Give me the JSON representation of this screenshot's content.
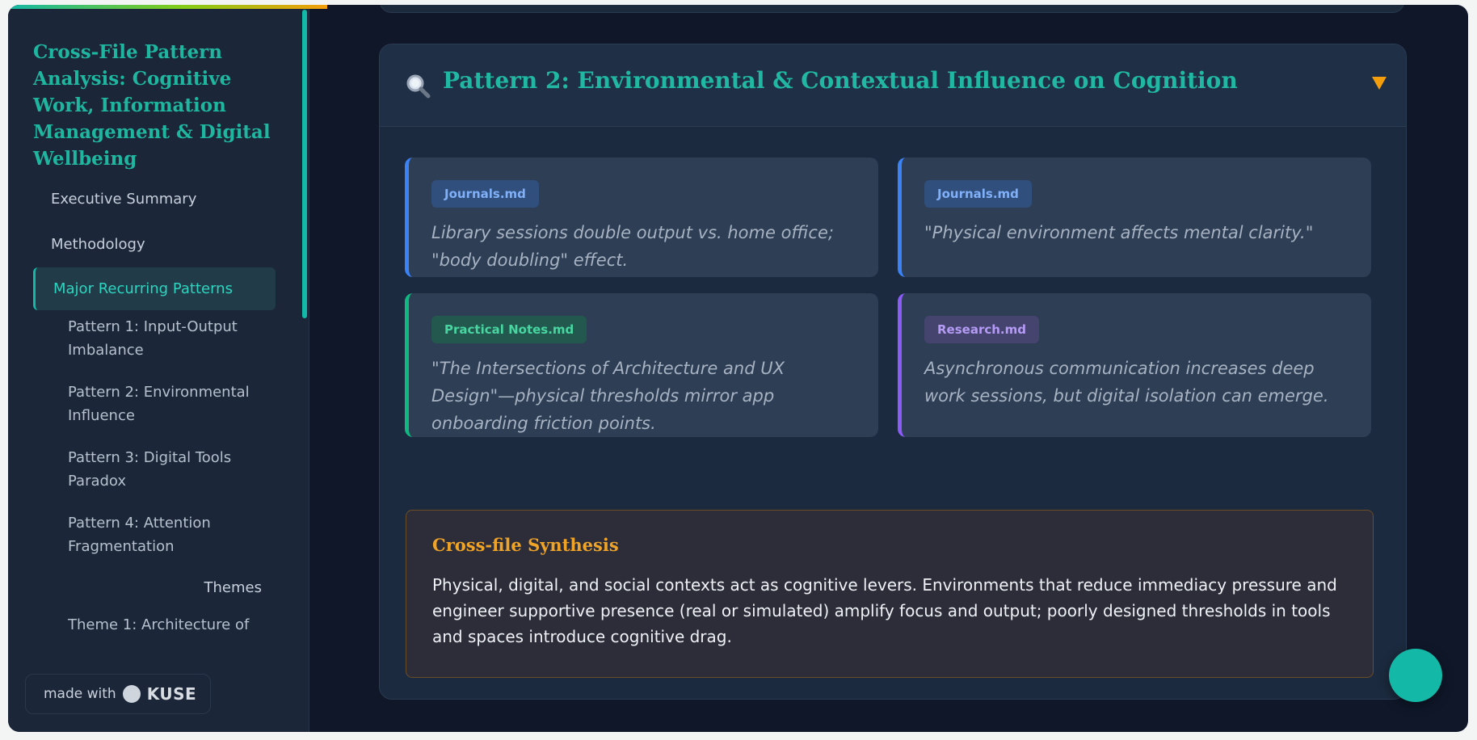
{
  "sidebar": {
    "title": "Cross-File Pattern Analysis: Cognitive Work, Information Management & Digital Wellbeing",
    "items": [
      {
        "label": "Executive Summary"
      },
      {
        "label": "Methodology"
      },
      {
        "label": "Major Recurring Patterns",
        "active": true
      }
    ],
    "subitems": [
      {
        "label": "Pattern 1: Input-Output Imbalance"
      },
      {
        "label": "Pattern 2: Environmental Influence"
      },
      {
        "label": "Pattern 3: Digital Tools Paradox"
      },
      {
        "label": "Pattern 4: Attention Fragmentation"
      }
    ],
    "partial_item": "Themes",
    "partial_subitem": "Theme 1: Architecture of"
  },
  "badge": {
    "made_with": "made with",
    "brand": "KUSE"
  },
  "pattern": {
    "icon": "search-icon",
    "title": "Pattern 2: Environmental & Contextual Influence on Cognition",
    "caret": "chevron-down-icon",
    "evidence": [
      {
        "source": "Journals.md",
        "quote": "Library sessions double output vs. home office; \"body doubling\" effect.",
        "accent": "#3b82f6"
      },
      {
        "source": "Journals.md",
        "quote": "\"Physical environment affects mental clarity.\"",
        "accent": "#3b82f6"
      },
      {
        "source": "Practical Notes.md",
        "quote": "\"The Intersections of Architecture and UX Design\"—physical thresholds mirror app onboarding friction points.",
        "accent": "#10b981"
      },
      {
        "source": "Research.md",
        "quote": "Asynchronous communication increases deep work sessions, but digital isolation can emerge.",
        "accent": "#8b5cf6"
      }
    ],
    "synthesis": {
      "title": "Cross-file Synthesis",
      "body": "Physical, digital, and social contexts act as cognitive levers. Environments that reduce immediacy pressure and engineer supportive presence (real or simulated) amplify focus and output; poorly designed thresholds in tools and spaces introduce cognitive drag."
    }
  },
  "colors": {
    "accent_teal": "#14b8a6",
    "accent_amber": "#f59e0b",
    "background": "#0f1729"
  }
}
